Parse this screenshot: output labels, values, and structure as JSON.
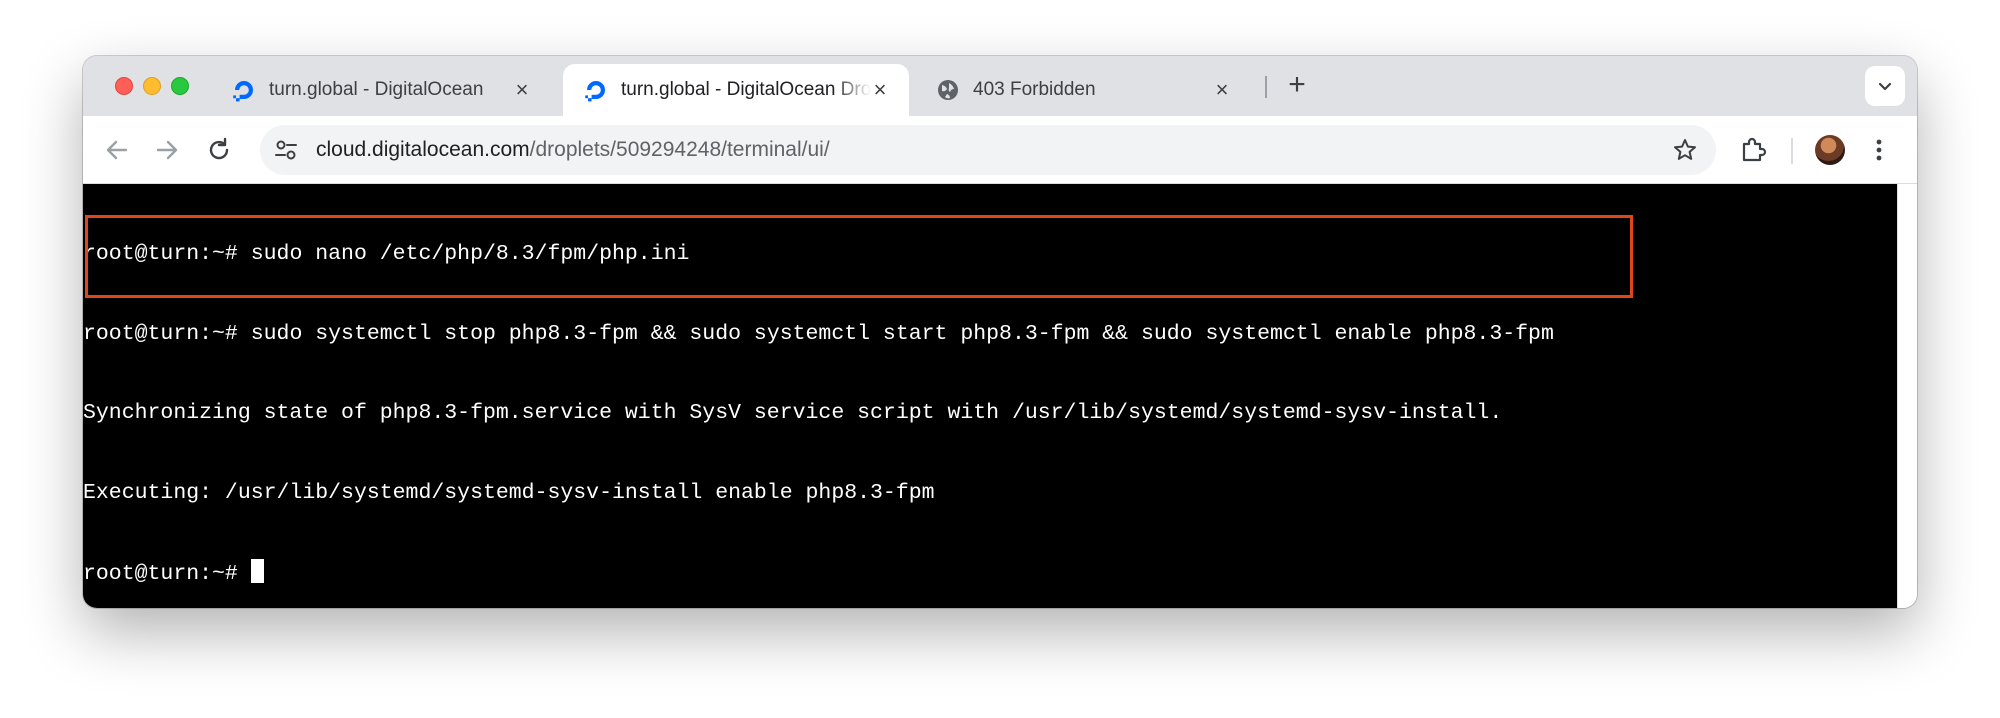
{
  "browser": {
    "tabs": [
      {
        "title": "turn.global - DigitalOcean",
        "icon": "digitalocean-icon",
        "active": false
      },
      {
        "title": "turn.global - DigitalOcean Dro",
        "icon": "digitalocean-icon",
        "active": true
      },
      {
        "title": "403 Forbidden",
        "icon": "globe-icon",
        "active": false
      }
    ],
    "address_bar": {
      "host": "cloud.digitalocean.com",
      "path": "/droplets/509294248/terminal/ui/"
    }
  },
  "terminal": {
    "lines": [
      {
        "prompt": "root@turn:~# ",
        "text": "sudo nano /etc/php/8.3/fpm/php.ini"
      },
      {
        "prompt": "root@turn:~# ",
        "text": "sudo systemctl stop php8.3-fpm && sudo systemctl start php8.3-fpm && sudo systemctl enable php8.3-fpm"
      },
      {
        "prompt": "",
        "text": "Synchronizing state of php8.3-fpm.service with SysV service script with /usr/lib/systemd/systemd-sysv-install."
      },
      {
        "prompt": "",
        "text": "Executing: /usr/lib/systemd/systemd-sysv-install enable php8.3-fpm"
      },
      {
        "prompt": "root@turn:~# ",
        "text": ""
      }
    ],
    "highlight_color": "#e0461b"
  },
  "colors": {
    "digitalocean_blue": "#0069ff",
    "terminal_bg": "#000000"
  }
}
